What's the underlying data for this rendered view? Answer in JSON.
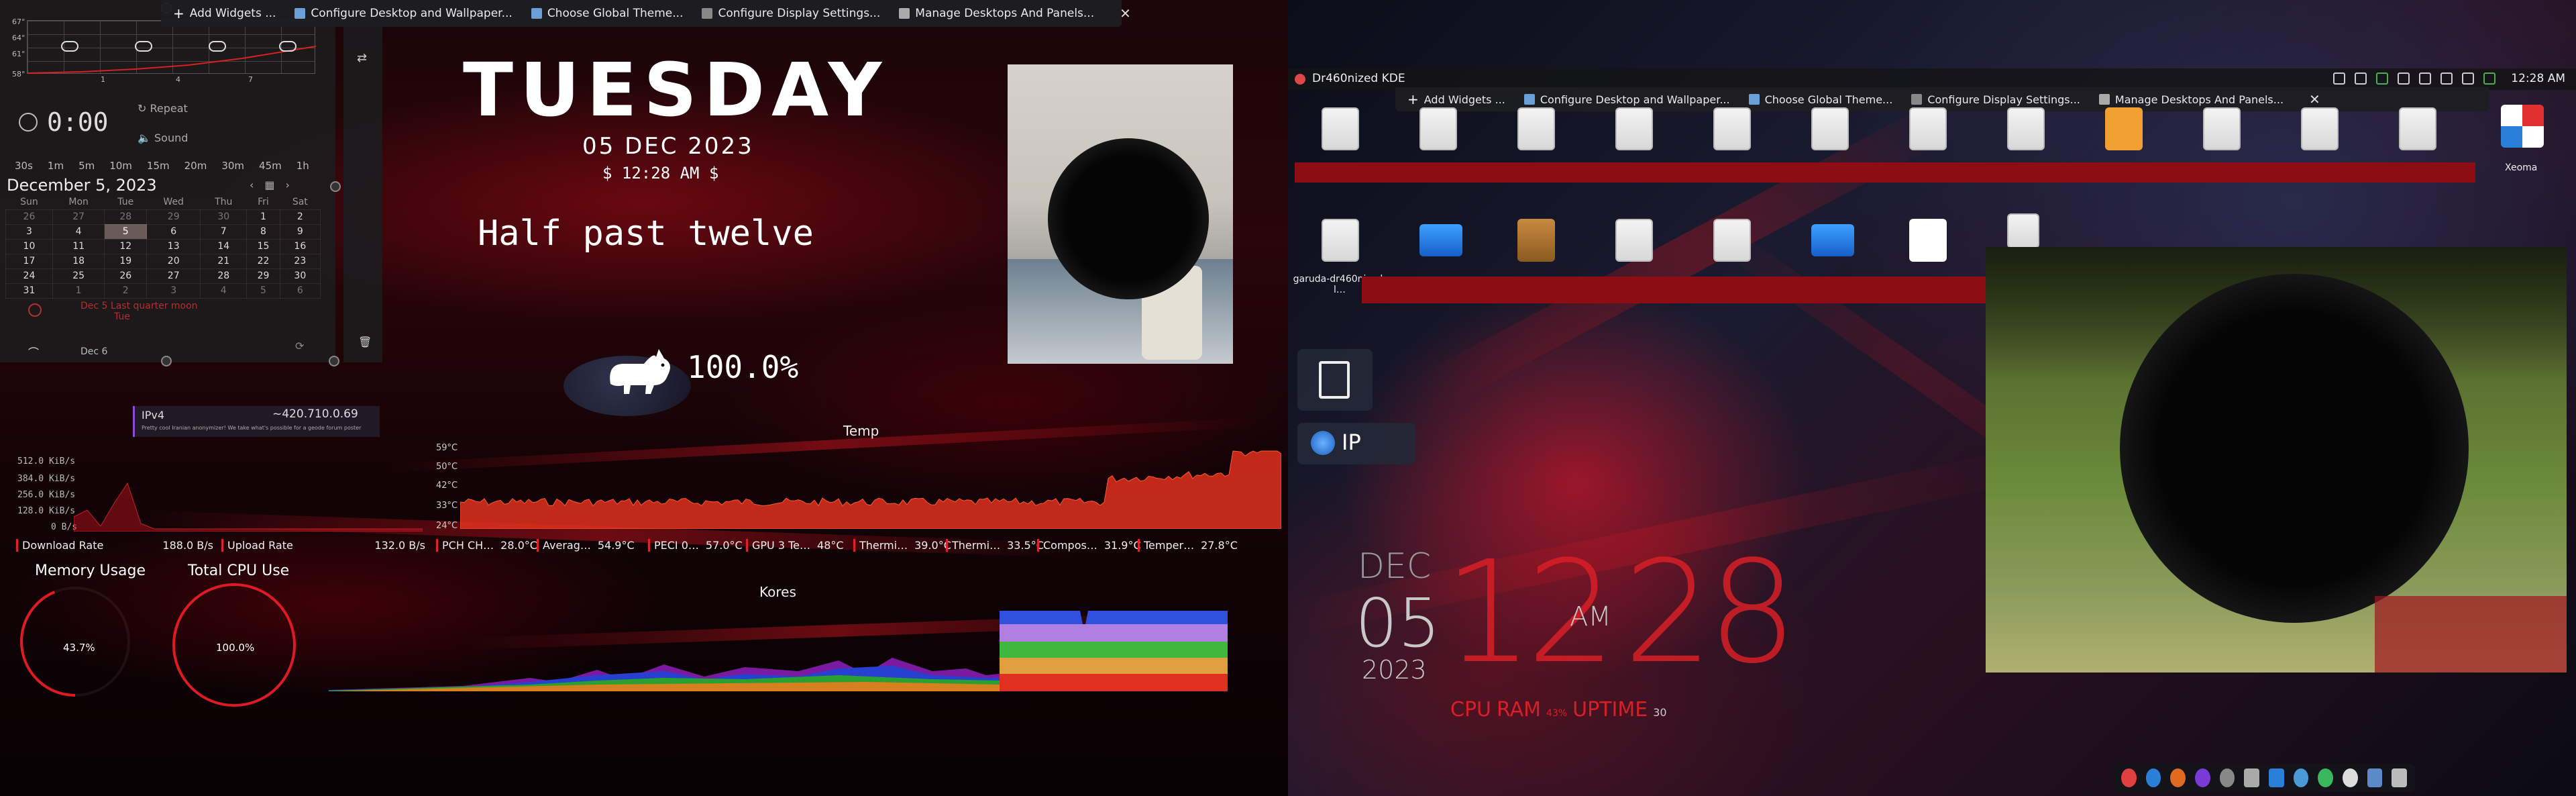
{
  "widget_menu": {
    "items": [
      "Add Widgets ...",
      "Configure Desktop and Wallpaper...",
      "Choose Global Theme...",
      "Configure Display Settings...",
      "Manage Desktops And Panels..."
    ],
    "close": "✕"
  },
  "weather": {
    "y_labels": [
      "67°",
      "64°",
      "61°",
      "58°"
    ],
    "x_ticks": [
      "1",
      "4",
      "7"
    ]
  },
  "timer": {
    "value": "0:00",
    "repeat_label": "Repeat",
    "sound_label": "Sound"
  },
  "time_pills": [
    "30s",
    "1m",
    "5m",
    "10m",
    "15m",
    "20m",
    "30m",
    "45m",
    "1h"
  ],
  "calendar": {
    "title": "December 5, 2023",
    "weekdays": [
      "Sun",
      "Mon",
      "Tue",
      "Wed",
      "Thu",
      "Fri",
      "Sat"
    ],
    "weeks": [
      [
        "26",
        "27",
        "28",
        "29",
        "30",
        "1",
        "2"
      ],
      [
        "3",
        "4",
        "5",
        "6",
        "7",
        "8",
        "9"
      ],
      [
        "10",
        "11",
        "12",
        "13",
        "14",
        "15",
        "16"
      ],
      [
        "17",
        "18",
        "19",
        "20",
        "21",
        "22",
        "23"
      ],
      [
        "24",
        "25",
        "26",
        "27",
        "28",
        "29",
        "30"
      ],
      [
        "31",
        "1",
        "2",
        "3",
        "4",
        "5",
        "6"
      ]
    ],
    "event_text": "Dec 5 Last quarter moon",
    "event_sub": "Tue",
    "footer_date": "Dec 6"
  },
  "desktop_clock": {
    "day": "TUESDAY",
    "date": "05 DEC 2023",
    "time": "$ 12:28 AM $",
    "phrase": "Half past twelve",
    "battery": "100.0%"
  },
  "network": {
    "ipv4_label": "IPv4",
    "ipv4_value": "~420.710.0.69",
    "ipv4_note": "Pretty cool Iranian anonymizer! We take what's possible for a geode forum poster",
    "y_labels": [
      "512.0 KiB/s",
      "384.0 KiB/s",
      "256.0 KiB/s",
      "128.0 KiB/s",
      "0 B/s"
    ],
    "download_label": "Download Rate",
    "download_value": "188.0 B/s",
    "upload_label": "Upload Rate",
    "upload_value": "132.0 B/s"
  },
  "temp": {
    "title": "Temp",
    "y_labels": [
      "59°C",
      "50°C",
      "42°C",
      "33°C",
      "24°C"
    ],
    "sensors": [
      {
        "name": "PCH CH…",
        "value": "28.0°C"
      },
      {
        "name": "Averag…",
        "value": "54.9°C"
      },
      {
        "name": "PECI 0…",
        "value": "57.0°C"
      },
      {
        "name": "GPU 3 Te…",
        "value": "48°C"
      },
      {
        "name": "Thermi…",
        "value": "39.0°C"
      },
      {
        "name": "Thermi…",
        "value": "33.5°C"
      },
      {
        "name": "Compos…",
        "value": "31.9°C"
      },
      {
        "name": "Temper…",
        "value": "27.8°C"
      }
    ]
  },
  "gauges": {
    "memory_title": "Memory Usage",
    "memory_value": "43.7%",
    "memory_fraction": 0.437,
    "cpu_title": "Total CPU Use",
    "cpu_value": "100.0%",
    "cpu_fraction": 1.0
  },
  "kores": {
    "title": "Kores"
  },
  "right_panel": {
    "title": "Dr460nized KDE",
    "clock": "12:28 AM",
    "garuda_icon_label": "garuda-dr460nized-l…",
    "xeoma_label": "Xeoma",
    "ip_button": "IP"
  },
  "big_clock": {
    "month": "DEC",
    "day": "05",
    "year": "2023",
    "hour": "12",
    "ampm": "AM",
    "minute": "28",
    "cpu_label": "CPU",
    "ram_label": "RAM",
    "ram_value": "43%",
    "uptime_label": "UPTIME",
    "uptime_value": "30"
  },
  "colors": {
    "accent_red": "#d81f26",
    "panel_bg": "#1c1c1e",
    "temp_fill": "#e0301e",
    "gauge_red": "#e01a24"
  }
}
